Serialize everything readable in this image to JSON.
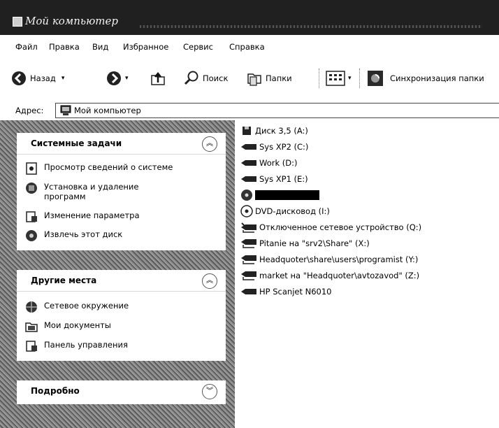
{
  "window": {
    "title": "Мой компьютер"
  },
  "menu": [
    "Файл",
    "Правка",
    "Вид",
    "Избранное",
    "Сервис",
    "Справка"
  ],
  "toolbar": {
    "back": "Назад",
    "search": "Поиск",
    "folders": "Папки",
    "sync": "Синхронизация папки"
  },
  "address": {
    "label": "Адрес:",
    "value": "Мой компьютер"
  },
  "panels": {
    "system_tasks": {
      "title": "Системные задачи",
      "items": [
        "Просмотр сведений о системе",
        "Установка и удаление программ",
        "Изменение параметра",
        "Извлечь этот диск"
      ]
    },
    "other_places": {
      "title": "Другие места",
      "items": [
        "Сетевое окружение",
        "Мои документы",
        "Панель управления"
      ]
    },
    "details": {
      "title": "Подробно"
    }
  },
  "drives": [
    "Диск 3,5 (A:)",
    "Sys XP2 (C:)",
    "Work (D:)",
    "Sys XP1 (E:)",
    "",
    "DVD-дисковод (I:)",
    "Отключенное сетевое устройство (Q:)",
    "Pitanie на \"srv2\\Share\" (X:)",
    "Headquoter\\share\\users\\programist (Y:)",
    "market на \"Headquoter\\avtozavod\" (Z:)",
    "HP Scanjet N6010"
  ]
}
